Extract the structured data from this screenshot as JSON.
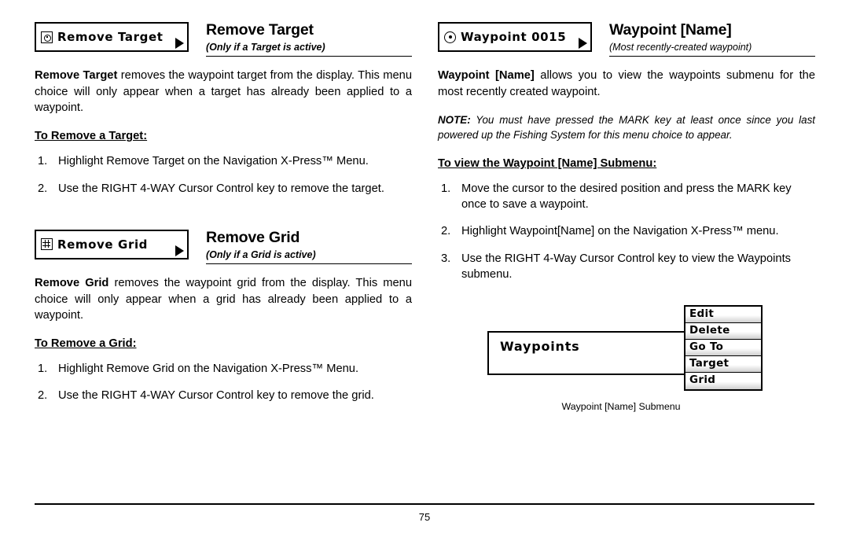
{
  "page": {
    "number": "75"
  },
  "left_column": {
    "sections": [
      {
        "lcd_label": "Remove Target",
        "lcd_icon": "target-icon",
        "title": "Remove Target",
        "subtitle": "(Only if a Target is active)",
        "body_bold": "Remove Target",
        "body_rest": " removes the waypoint target from the display. This menu choice will only appear when a target has already been applied to a waypoint.",
        "sub_head": "To Remove a Target:",
        "steps": [
          "Highlight Remove Target on the Navigation X-Press™ Menu.",
          "Use the RIGHT 4-WAY Cursor Control key to remove the target."
        ]
      },
      {
        "lcd_label": "Remove Grid",
        "lcd_icon": "grid-icon",
        "title": "Remove Grid",
        "subtitle": "(Only if a Grid is active)",
        "body_bold": "Remove Grid",
        "body_rest": " removes the waypoint grid from the display. This menu choice will only appear when a grid has already been applied to a waypoint.",
        "sub_head": "To Remove a Grid:",
        "steps": [
          "Highlight Remove Grid on the Navigation X-Press™ Menu.",
          "Use the RIGHT 4-WAY Cursor Control key to remove the grid."
        ]
      }
    ]
  },
  "right_column": {
    "section": {
      "lcd_label": "Waypoint 0015",
      "lcd_icon": "waypoint-icon",
      "title": "Waypoint [Name]",
      "subtitle": "(Most recently-created waypoint)",
      "body_bold": "Waypoint [Name]",
      "body_rest": " allows you to view the waypoints submenu for the most recently created waypoint.",
      "note_tag": "NOTE:",
      "note_text": " You must have pressed the MARK key at least once since you last powered up the Fishing System for this menu choice to appear.",
      "sub_head": "To view the Waypoint [Name] Submenu:",
      "steps": [
        "Move the cursor to the desired position and press the MARK key once to save a waypoint.",
        "Highlight Waypoint[Name] on the Navigation X-Press™ menu.",
        "Use the RIGHT 4-Way Cursor Control key to view the Waypoints submenu."
      ]
    },
    "figure": {
      "panel_label": "Waypoints",
      "menu_items": [
        "Edit",
        "Delete",
        "Go To",
        "Target",
        "Grid"
      ],
      "caption": "Waypoint [Name] Submenu"
    }
  }
}
